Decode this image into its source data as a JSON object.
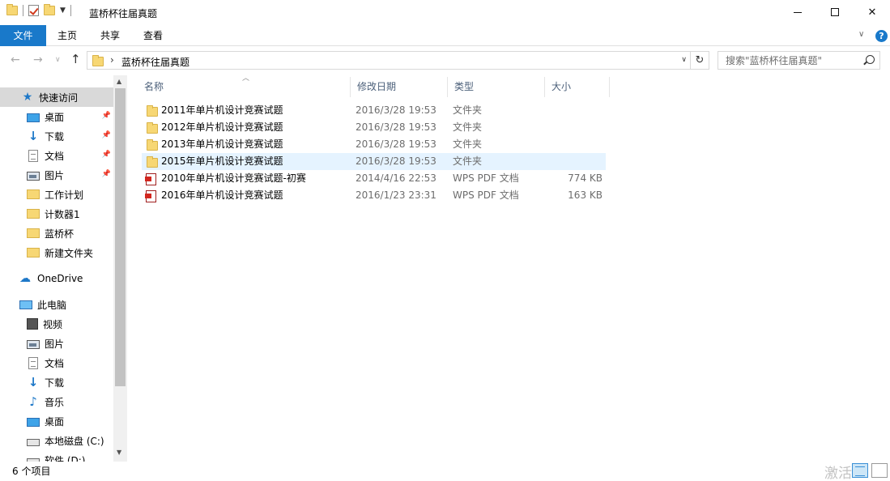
{
  "window": {
    "title": "蓝桥杯往届真题"
  },
  "ribbon": {
    "tabs": [
      "文件",
      "主页",
      "共享",
      "查看"
    ]
  },
  "address": {
    "path": "蓝桥杯往届真题",
    "search_placeholder": "搜索\"蓝桥杯往届真题\""
  },
  "sidebar": {
    "quick_access": {
      "label": "快速访问",
      "icon": "star-icon"
    },
    "quick_items": [
      {
        "label": "桌面",
        "icon": "desktop-icon",
        "pinned": true
      },
      {
        "label": "下载",
        "icon": "download-icon",
        "pinned": true
      },
      {
        "label": "文档",
        "icon": "document-icon",
        "pinned": true
      },
      {
        "label": "图片",
        "icon": "pictures-icon",
        "pinned": true
      },
      {
        "label": "工作计划",
        "icon": "folder-icon",
        "pinned": false
      },
      {
        "label": "计数器1",
        "icon": "folder-icon",
        "pinned": false
      },
      {
        "label": "蓝桥杯",
        "icon": "folder-icon",
        "pinned": false
      },
      {
        "label": "新建文件夹",
        "icon": "folder-icon",
        "pinned": false
      }
    ],
    "onedrive": {
      "label": "OneDrive",
      "icon": "cloud-icon"
    },
    "this_pc": {
      "label": "此电脑",
      "icon": "computer-icon"
    },
    "pc_items": [
      {
        "label": "视频",
        "icon": "video-icon"
      },
      {
        "label": "图片",
        "icon": "pictures-icon"
      },
      {
        "label": "文档",
        "icon": "document-icon"
      },
      {
        "label": "下载",
        "icon": "download-icon"
      },
      {
        "label": "音乐",
        "icon": "music-icon"
      },
      {
        "label": "桌面",
        "icon": "desktop-icon"
      },
      {
        "label": "本地磁盘 (C:)",
        "icon": "disk-icon"
      },
      {
        "label": "软件 (D:)",
        "icon": "disk-icon"
      }
    ]
  },
  "columns": {
    "name": "名称",
    "date": "修改日期",
    "type": "类型",
    "size": "大小"
  },
  "files": [
    {
      "name": "2011年单片机设计竞赛试题",
      "date": "2016/3/28 19:53",
      "type": "文件夹",
      "size": "",
      "icon": "folder-icon"
    },
    {
      "name": "2012年单片机设计竞赛试题",
      "date": "2016/3/28 19:53",
      "type": "文件夹",
      "size": "",
      "icon": "folder-icon"
    },
    {
      "name": "2013年单片机设计竞赛试题",
      "date": "2016/3/28 19:53",
      "type": "文件夹",
      "size": "",
      "icon": "folder-icon"
    },
    {
      "name": "2015年单片机设计竞赛试题",
      "date": "2016/3/28 19:53",
      "type": "文件夹",
      "size": "",
      "icon": "folder-icon",
      "highlighted": true
    },
    {
      "name": "2010年单片机设计竞赛试题-初赛",
      "date": "2014/4/16 22:53",
      "type": "WPS PDF 文档",
      "size": "774 KB",
      "icon": "pdf-icon"
    },
    {
      "name": "2016年单片机设计竞赛试题",
      "date": "2016/1/23 23:31",
      "type": "WPS PDF 文档",
      "size": "163 KB",
      "icon": "pdf-icon"
    }
  ],
  "status": {
    "item_count": "6 个项目"
  },
  "watermark": "激活Wi",
  "colors": {
    "accent": "#1979ca",
    "hover_row": "#e5f3ff",
    "folder": "#f7d774"
  }
}
